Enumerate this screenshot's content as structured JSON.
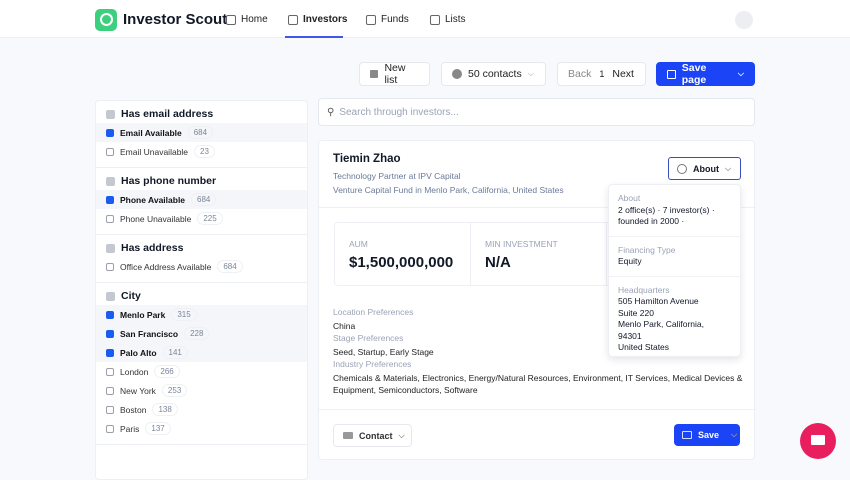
{
  "header": {
    "brand": "Investor Scout",
    "nav": [
      "Home",
      "Investors",
      "Funds",
      "Lists"
    ],
    "active": "Investors"
  },
  "toolbar": {
    "new_list": "New list",
    "contacts": "50 contacts",
    "back": "Back",
    "page": "1",
    "next": "Next",
    "save_page": "Save page"
  },
  "search": {
    "placeholder": "Search through investors..."
  },
  "filters": [
    {
      "title": "Has email address",
      "icon": "mail-icon",
      "items": [
        {
          "label": "Email Available",
          "count": "684",
          "checked": true
        },
        {
          "label": "Email Unavailable",
          "count": "23",
          "checked": false
        }
      ]
    },
    {
      "title": "Has phone number",
      "icon": "phone-icon",
      "items": [
        {
          "label": "Phone Available",
          "count": "684",
          "checked": true
        },
        {
          "label": "Phone Unavailable",
          "count": "225",
          "checked": false
        }
      ]
    },
    {
      "title": "Has address",
      "icon": "building-icon",
      "items": [
        {
          "label": "Office Address Available",
          "count": "684",
          "checked": false
        }
      ]
    },
    {
      "title": "City",
      "icon": "globe-icon",
      "items": [
        {
          "label": "Menlo Park",
          "count": "315",
          "checked": true
        },
        {
          "label": "San Francisco",
          "count": "228",
          "checked": true
        },
        {
          "label": "Palo Alto",
          "count": "141",
          "checked": true
        },
        {
          "label": "London",
          "count": "266",
          "checked": false
        },
        {
          "label": "New York",
          "count": "253",
          "checked": false
        },
        {
          "label": "Boston",
          "count": "138",
          "checked": false
        },
        {
          "label": "Paris",
          "count": "137",
          "checked": false
        }
      ]
    }
  ],
  "investor": {
    "name": "Tiemin Zhao",
    "title": "Technology Partner at IPV Capital",
    "fund": "Venture Capital Fund in Menlo Park, California, United States",
    "aum_label": "AUM",
    "aum": "$1,500,000,000",
    "min_label": "MIN INVESTMENT",
    "min": "N/A",
    "loc_label": "Location Preferences",
    "loc": "China",
    "stage_label": "Stage Preferences",
    "stage": "Seed, Startup, Early Stage",
    "ind_label": "Industry Preferences",
    "ind": "Chemicals & Materials, Electronics, Energy/Natural Resources, Environment, IT Services, Medical Devices & Equipment, Semiconductors, Software",
    "contact": "Contact",
    "save": "Save",
    "about_button": "About"
  },
  "about_dropdown": {
    "about_label": "About",
    "about": "2 office(s) · 7 investor(s) · founded in 2000 ·",
    "fin_label": "Financing Type",
    "fin": "Equity",
    "hq_label": "Headquarters",
    "hq": [
      "505 Hamilton Avenue",
      "Suite 220",
      "Menlo Park, California,",
      "94301",
      "United States"
    ]
  },
  "colors": {
    "primary": "#1a44f5",
    "brand": "#3ccf7e",
    "chat": "#e91e5e"
  }
}
